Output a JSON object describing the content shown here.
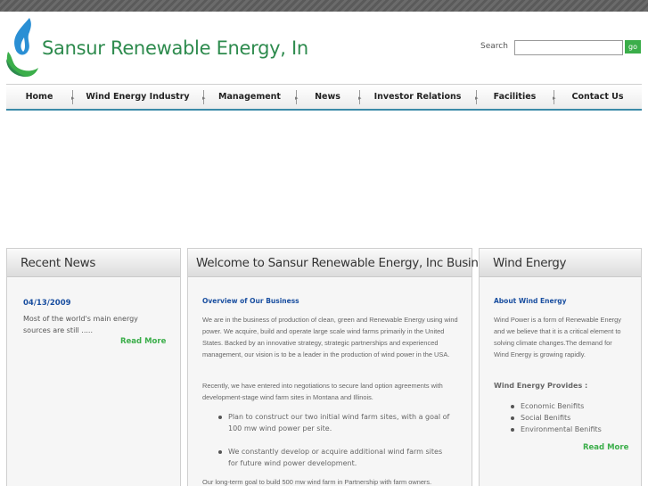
{
  "site": {
    "brand": "Sansur Renewable Energy, In"
  },
  "search": {
    "label": "Search",
    "value": "",
    "placeholder": "",
    "button": "go"
  },
  "nav": {
    "items": [
      "Home",
      "Wind Energy Industry",
      "Management",
      "News",
      "Investor Relations",
      "Facilities",
      "Contact Us"
    ]
  },
  "recent_news": {
    "title": "Recent News",
    "date": "04/13/2009",
    "text": "Most of the world's main energy sources are still .....",
    "read_more": "Read More"
  },
  "welcome": {
    "title": "Welcome to Sansur Renewable Energy, Inc Business",
    "subtitle": "Overview of Our Business",
    "para1": "We are in the business of production of clean, green and Renewable Energy using wind power. We acquire, build and operate large scale wind farms primarily in the United States. Backed by an innovative strategy, strategic partnerships and experienced management, our vision is to be a leader in the production of wind power in the USA.",
    "para2": "Recently, we have entered into negotiations to secure land option agreements with development-stage wind farm sites in Montana and Illinois.",
    "bullets": [
      "Plan to construct our two initial wind farm sites, with a goal of 100 mw wind power per site.",
      "We constantly develop or acquire additional wind farm sites for future wind power development."
    ],
    "para3": "Our long-term goal to build 500 mw wind farm in Partnership with farm owners."
  },
  "wind_energy": {
    "title": "Wind Energy",
    "subtitle": "About Wind Energy",
    "text": "Wind Power is a form of Renewable Energy and we believe that it is a critical element to solving climate changes.The demand for Wind Energy is growing rapidly.",
    "provides_title": "Wind Energy Provides :",
    "provides": [
      "Economic Benifits",
      "Social Benifits",
      "Environmental Benifits"
    ],
    "read_more": "Read More"
  },
  "colors": {
    "brand_green": "#2e8b4e",
    "accent_green": "#3bae4a",
    "link_blue": "#1a4fa0",
    "logo_blue": "#2a8fd4"
  },
  "icons": {
    "logo": "flame-leaf-logo-icon"
  }
}
